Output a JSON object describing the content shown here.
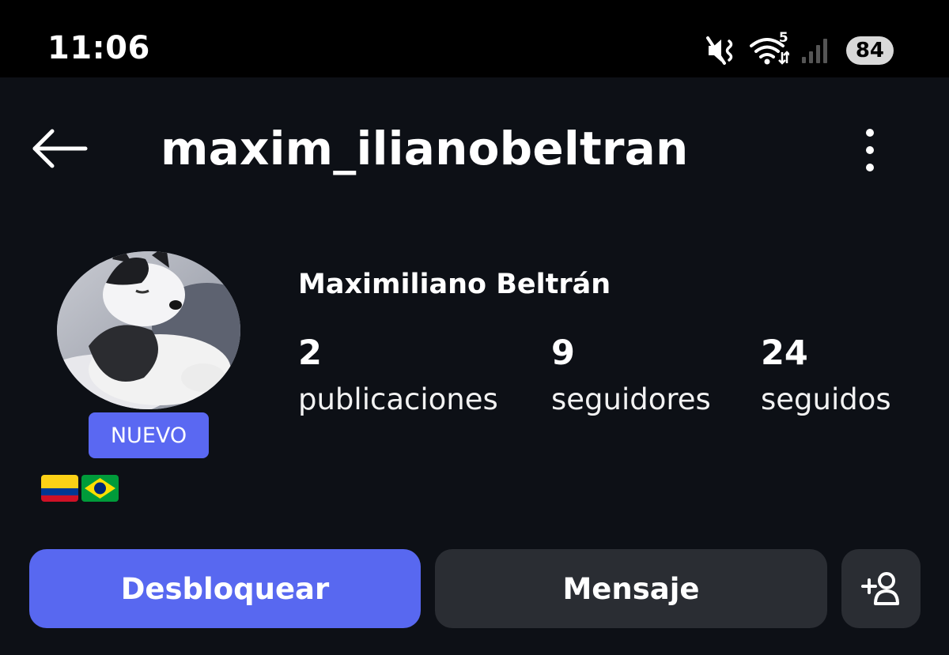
{
  "status_bar": {
    "time": "11:06",
    "wifi_label": "5",
    "battery": "84",
    "icons": [
      "mute-vibrate-icon",
      "wifi-icon",
      "signal-icon",
      "battery-icon"
    ]
  },
  "header": {
    "username": "maxim_ilianobeltran",
    "back_icon": "arrow-left-icon",
    "more_icon": "more-vertical-icon"
  },
  "profile": {
    "display_name": "Maximiliano Beltrán",
    "badge": "NUEVO",
    "flags": [
      "colombia-flag",
      "brazil-flag"
    ],
    "stats": [
      {
        "value": "2",
        "label": "publicaciones"
      },
      {
        "value": "9",
        "label": "seguidores"
      },
      {
        "value": "24",
        "label": "seguidos"
      }
    ]
  },
  "actions": {
    "unblock_label": "Desbloquear",
    "message_label": "Mensaje",
    "add_friend_icon": "add-person-icon"
  },
  "colors": {
    "primary": "#5868f0",
    "secondary_button": "#2a2d33",
    "background": "#0d1016"
  }
}
